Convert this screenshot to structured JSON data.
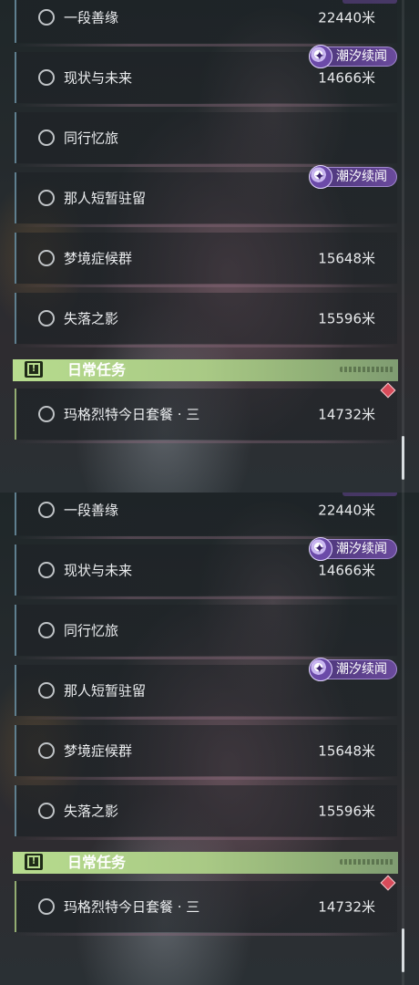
{
  "quests": [
    {
      "name": "一段善缘",
      "distance": "22440米"
    },
    {
      "name": "现状与未来",
      "distance": "14666米"
    },
    {
      "name": "同行忆旅",
      "distance": ""
    },
    {
      "name": "那人短暂驻留",
      "distance": ""
    },
    {
      "name": "梦境症候群",
      "distance": "15648米"
    },
    {
      "name": "失落之影",
      "distance": "15596米"
    }
  ],
  "badge_label": "潮汐续闻",
  "section": {
    "title": "日常任务"
  },
  "daily_quest": {
    "name": "玛格烈特今日套餐 · 三",
    "distance": "14732米"
  },
  "colors": {
    "badge": "#6a4a9c",
    "section_bar": "#b7dc8e",
    "tracked_marker": "#d84b5a"
  },
  "icons": {
    "quest_status": "circle-outline-icon",
    "badge": "tidal-sequel-icon",
    "section": "alert-box-icon",
    "marker": "diamond-marker-icon"
  }
}
